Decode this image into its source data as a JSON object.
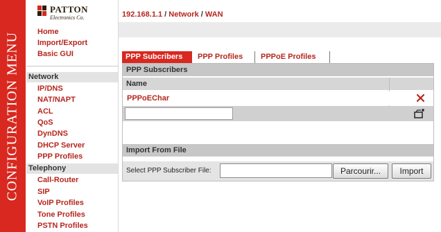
{
  "banner": {
    "text": "CONFIGURATION MENU"
  },
  "logo": {
    "word": "PATTON",
    "sub": "Electronics Co."
  },
  "nav": {
    "top_items": [
      "Home",
      "Import/Export",
      "Basic GUI"
    ],
    "network_header": "Network",
    "network_items": [
      "IP/DNS",
      "NAT/NAPT",
      "ACL",
      "QoS",
      "DynDNS",
      "DHCP Server",
      "PPP Profiles"
    ],
    "telephony_header": "Telephony",
    "telephony_items": [
      "Call-Router",
      "SIP",
      "VoIP Profiles",
      "Tone Profiles",
      "PSTN Profiles"
    ]
  },
  "breadcrumb": {
    "ip": "192.168.1.1",
    "sep1": " / ",
    "section": "Network",
    "sep2": " / ",
    "page": "WAN"
  },
  "tabs": [
    "PPP Subcribers",
    "PPP Profiles",
    "PPPoE Profiles"
  ],
  "panel": {
    "title": "PPP Subscribers",
    "name_header": "Name",
    "rows": [
      {
        "name": "PPPoEChar"
      }
    ],
    "new_value": "",
    "import_title": "Import From File",
    "file_label": "Select PPP Subscriber File:",
    "browse_label": "Parcourir...",
    "import_label": "Import"
  },
  "colors": {
    "accent": "#d8281f",
    "link": "#b5261e"
  },
  "icons": {
    "delete": "delete-x-icon",
    "add": "add-new-icon"
  }
}
